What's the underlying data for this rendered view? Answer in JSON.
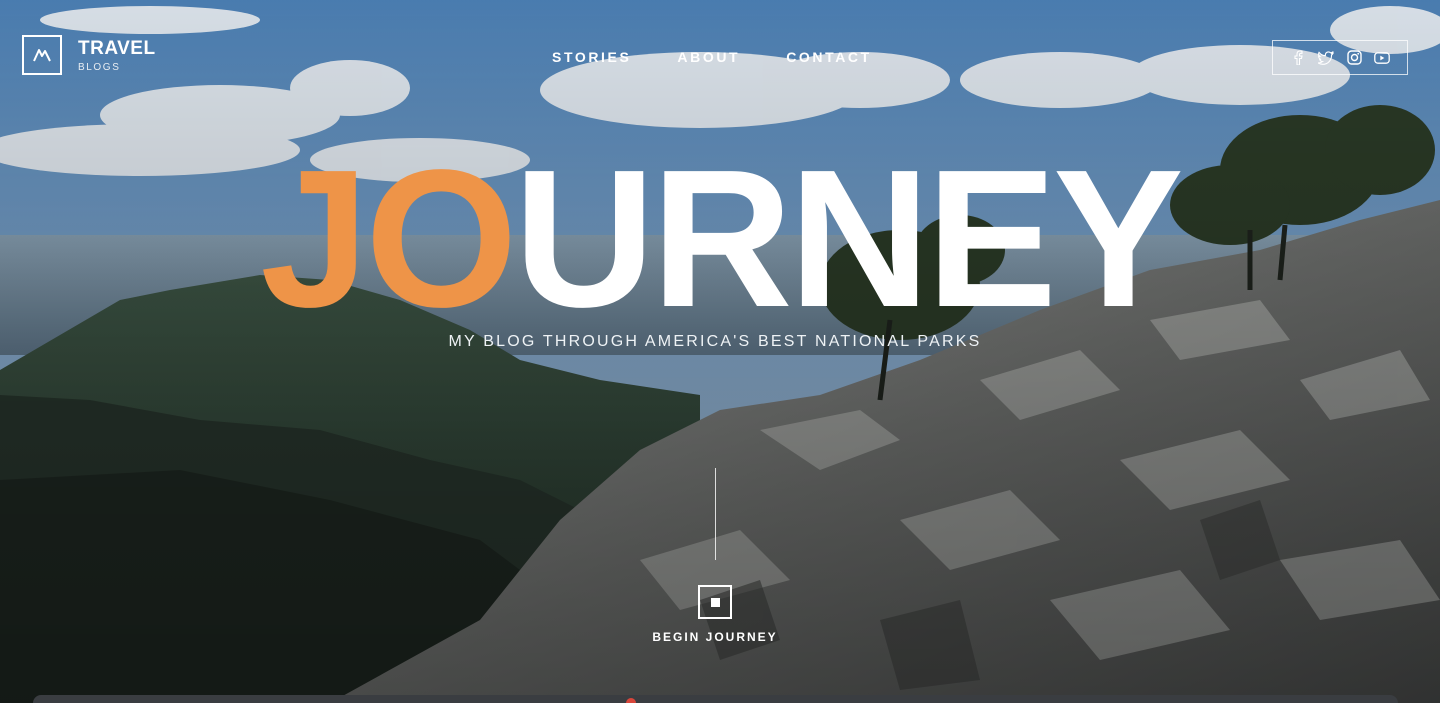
{
  "brand": {
    "title": "TRAVEL",
    "subtitle": "BLOGS",
    "icon": "mountain-icon"
  },
  "nav": {
    "items": [
      {
        "label": "STORIES"
      },
      {
        "label": "ABOUT"
      },
      {
        "label": "CONTACT"
      }
    ]
  },
  "social": {
    "icons": [
      "facebook-icon",
      "twitter-icon",
      "instagram-icon",
      "youtube-icon"
    ]
  },
  "hero": {
    "title_accent": "JO",
    "title_rest": "URNEY",
    "subtitle": "MY BLOG THROUGH AMERICA'S BEST NATIONAL PARKS",
    "cta_label": "BEGIN JOURNEY"
  },
  "colors": {
    "accent": "#ee9448",
    "text": "#ffffff"
  }
}
